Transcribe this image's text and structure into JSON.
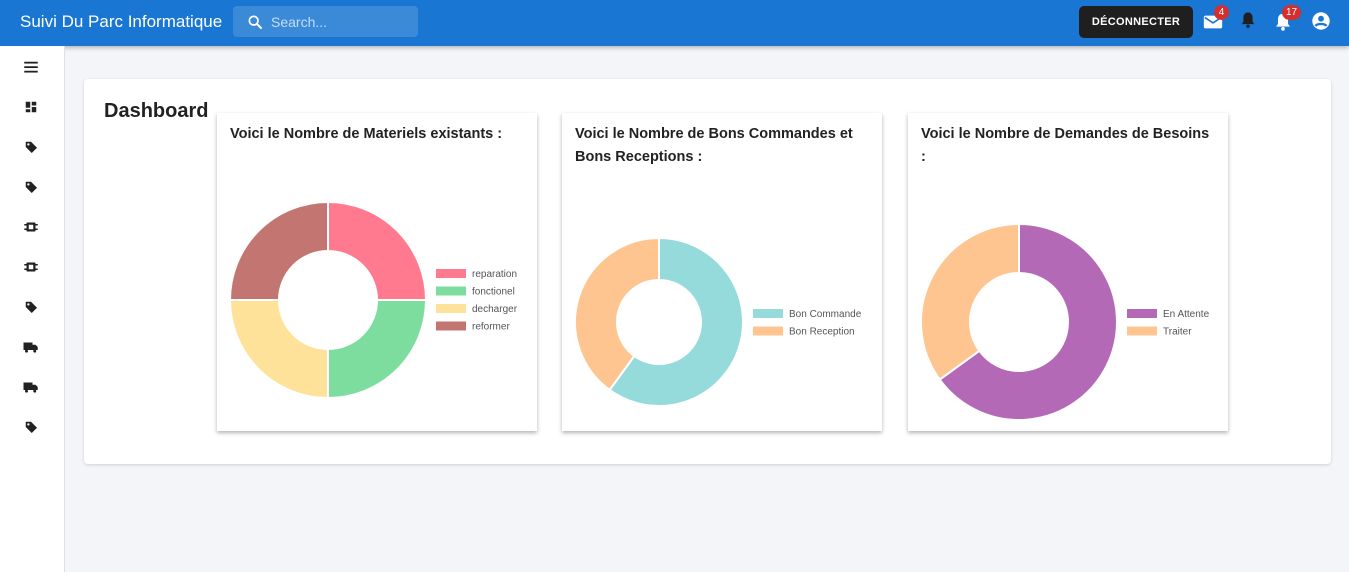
{
  "app": {
    "title": "Suivi Du Parc Informatique"
  },
  "search": {
    "placeholder": "Search..."
  },
  "header": {
    "logout_label": "DÉCONNECTER",
    "mail_badge": "4",
    "notifications_badge": "17"
  },
  "sidebar": {
    "items": [
      {
        "icon": "menu-icon"
      },
      {
        "icon": "dashboard-icon"
      },
      {
        "icon": "tag-icon"
      },
      {
        "icon": "tag-icon"
      },
      {
        "icon": "chip-icon"
      },
      {
        "icon": "chip-icon"
      },
      {
        "icon": "tag-icon"
      },
      {
        "icon": "truck-icon"
      },
      {
        "icon": "truck-icon"
      },
      {
        "icon": "tag-icon"
      }
    ]
  },
  "dashboard": {
    "title": "Dashboard"
  },
  "cards": [
    {
      "title": "Voici le Nombre de Materiels existants :"
    },
    {
      "title": "Voici le Nombre de Bons Commandes et Bons Receptions :"
    },
    {
      "title": "Voici le Nombre de Demandes de Besoins :"
    }
  ],
  "chart_data": [
    {
      "type": "pie",
      "doughnut": true,
      "legend": "right",
      "categories": [
        "reparation",
        "fonctionel",
        "decharger",
        "reformer"
      ],
      "values": [
        1,
        1,
        1,
        1
      ],
      "colors": [
        "#ff7a8f",
        "#7ddd9e",
        "#ffe29a",
        "#c27571"
      ]
    },
    {
      "type": "pie",
      "doughnut": true,
      "legend": "right",
      "categories": [
        "Bon Commande",
        "Bon Reception"
      ],
      "values": [
        0.6,
        0.4
      ],
      "colors": [
        "#96dbdb",
        "#ffc590"
      ]
    },
    {
      "type": "pie",
      "doughnut": true,
      "legend": "right",
      "categories": [
        "En Attente",
        "Traiter"
      ],
      "values": [
        0.65,
        0.35
      ],
      "colors": [
        "#b469b6",
        "#ffc590"
      ]
    }
  ]
}
